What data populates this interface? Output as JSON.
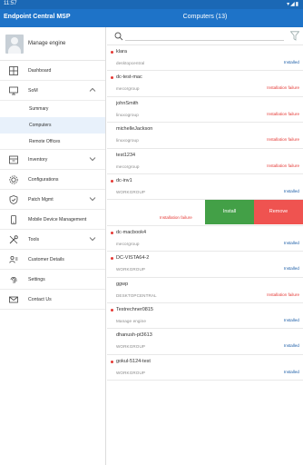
{
  "statusbar": {
    "time": "11:57"
  },
  "appbar": {
    "app_title": "Endpoint Central MSP",
    "page_title": "Computers (13)"
  },
  "sidebar": {
    "profile_name": "Manage engine",
    "items": [
      {
        "label": "Dashboard",
        "icon": "dashboard-icon"
      },
      {
        "label": "SoM",
        "icon": "monitor-icon",
        "expanded": true
      },
      {
        "label": "Inventory",
        "icon": "inventory-icon"
      },
      {
        "label": "Configurations",
        "icon": "configurations-icon"
      },
      {
        "label": "Patch Mgmt",
        "icon": "shield-icon"
      },
      {
        "label": "Mobile Device Management",
        "icon": "mobile-icon"
      },
      {
        "label": "Tools",
        "icon": "tools-icon"
      },
      {
        "label": "Customer Details",
        "icon": "customer-icon"
      },
      {
        "label": "Settings",
        "icon": "fingerprint-icon"
      },
      {
        "label": "Contact Us",
        "icon": "mail-icon"
      }
    ],
    "som_children": [
      {
        "label": "Summary"
      },
      {
        "label": "Computers",
        "active": true
      },
      {
        "label": "Remote Offices"
      }
    ]
  },
  "computers": [
    {
      "name": "klara",
      "domain": "desktopcentral",
      "status": "Installed"
    },
    {
      "name": "dc-test-mac",
      "domain": "mecorgroup",
      "status": "Installation failure"
    },
    {
      "name": "johnSmith",
      "domain": "linuxogroup",
      "status": "Installation failure"
    },
    {
      "name": "michelleJackson",
      "domain": "linuxogroup",
      "status": "Installation failure"
    },
    {
      "name": "test1234",
      "domain": "mecorgroup",
      "status": "Installation failure"
    },
    {
      "name": "dc-inv1",
      "domain": "WORKGROUP",
      "status": "Installed"
    },
    {
      "name": "",
      "domain": "",
      "status": "Installation failure",
      "actions": {
        "install": "Install",
        "remove": "Remove"
      }
    },
    {
      "name": "dc-macbook4",
      "domain": "mecorgroup",
      "status": "Installed"
    },
    {
      "name": "DC-VISTA64-2",
      "domain": "WORKGROUP",
      "status": "Installed"
    },
    {
      "name": "ggwp",
      "domain": "DESKTOPCENTRAL",
      "status": "Installation failure"
    },
    {
      "name": "Testrechner0815",
      "domain": "Manage engine",
      "status": "Installed"
    },
    {
      "name": "dhanush-pt3613",
      "domain": "WORKGROUP",
      "status": "Installed"
    },
    {
      "name": "gokul-5124-test",
      "domain": "WORKGROUP",
      "status": "Installed"
    }
  ],
  "colors": {
    "appbar": "#1e73c8",
    "installed": "#1e5fa8",
    "failure": "#e53935",
    "install_btn": "#43a047",
    "remove_btn": "#ef5350"
  }
}
